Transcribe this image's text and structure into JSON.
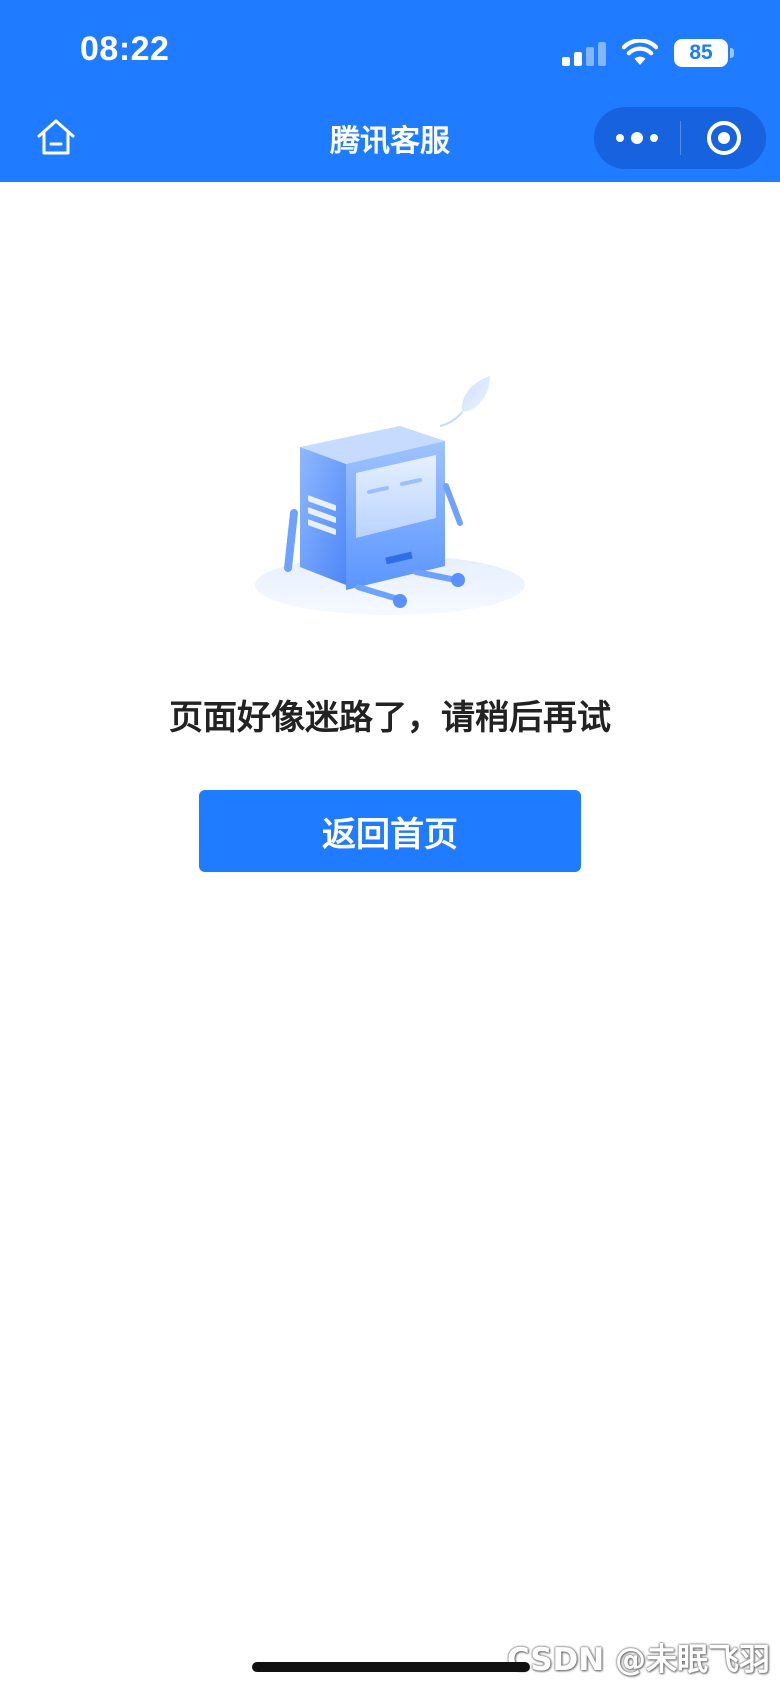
{
  "status_bar": {
    "time": "08:22",
    "battery_level": "85",
    "signal_bars_active": 2,
    "signal_bars_total": 4
  },
  "nav": {
    "title": "腾讯客服",
    "home_icon": "home-icon",
    "more_icon": "more-dots-icon",
    "close_icon": "close-circle-icon"
  },
  "main": {
    "illustration": "lost-robot-illustration",
    "error_message": "页面好像迷路了，请稍后再试",
    "back_home_label": "返回首页"
  },
  "watermark": {
    "text": "CSDN @未眠飞羽"
  },
  "colors": {
    "brand_blue": "#1f7bff",
    "text_dark": "#222222",
    "background": "#ffffff"
  }
}
